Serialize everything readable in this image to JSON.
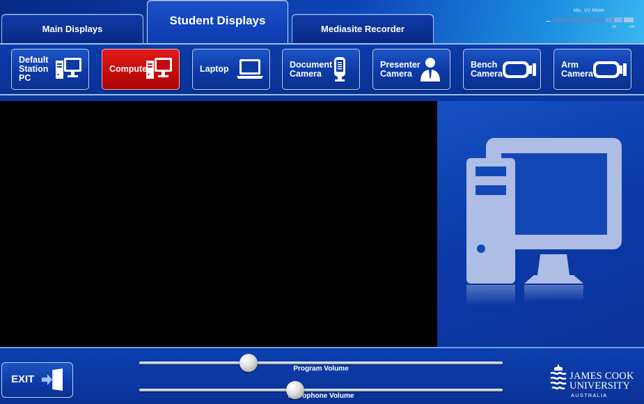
{
  "tabs": [
    {
      "label": "Main Displays",
      "active": false
    },
    {
      "label": "Student Displays",
      "active": true
    },
    {
      "label": "Mediasite Recorder",
      "active": false
    }
  ],
  "vu_meter": {
    "label": "Mic. VU Meter",
    "scale_min": "-00",
    "scale_max": "+00"
  },
  "sources": [
    {
      "label": "Default\nStation\nPC",
      "icon": "desktop-pc-icon",
      "selected": false
    },
    {
      "label": "Computer",
      "icon": "desktop-pc-icon",
      "selected": true
    },
    {
      "label": "Laptop",
      "icon": "laptop-icon",
      "selected": false
    },
    {
      "label": "Document\nCamera",
      "icon": "document-camera-icon",
      "selected": false
    },
    {
      "label": "Presenter\nCamera",
      "icon": "presenter-icon",
      "selected": false
    },
    {
      "label": "Bench\nCamera",
      "icon": "camera-icon",
      "selected": false
    },
    {
      "label": "Arm\nCamera",
      "icon": "camera-icon",
      "selected": false
    }
  ],
  "preview": {
    "icon": "desktop-pc-icon"
  },
  "exit": {
    "label": "EXIT",
    "icon": "exit-door-icon"
  },
  "program_volume": {
    "label": "Program Volume",
    "level": 0.3
  },
  "microphone_volume": {
    "label": "Microphone Volume",
    "level": 0.43
  },
  "logo": {
    "line1": "JAMES COOK",
    "line2": "UNIVERSITY",
    "line3": "AUSTRALIA"
  },
  "colors": {
    "selected": "#d01010",
    "accent": "#0b3aa8",
    "preview_icon": "#aebde6"
  }
}
